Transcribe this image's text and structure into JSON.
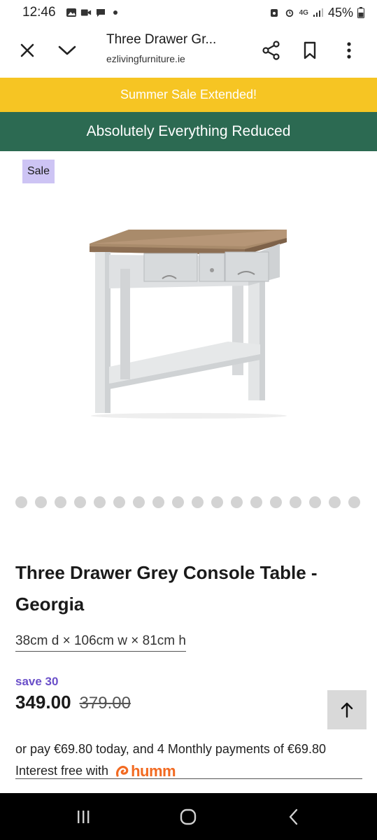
{
  "status_bar": {
    "time": "12:46",
    "battery": "45%",
    "network": "4G"
  },
  "browser": {
    "page_title": "Three Drawer Gr...",
    "url": "ezlivingfurniture.ie"
  },
  "banners": {
    "top": "Summer Sale Extended!",
    "bottom": "Absolutely Everything Reduced"
  },
  "product": {
    "badge": "Sale",
    "title": "Three Drawer Grey Console Table - Georgia",
    "dimensions": "38cm d × 106cm w × 81cm h",
    "save": "save 30",
    "price": "349.00",
    "old_price": "379.00",
    "image_count": 18
  },
  "payment": {
    "text": "or pay €69.80 today, and 4 Monthly payments of €69.80",
    "interest_text": "Interest free with",
    "provider": "humm"
  },
  "colors": {
    "yellow_banner": "#f6c523",
    "green_banner": "#2c6a52",
    "sale_badge": "#cdc4f4",
    "save_text": "#6a4fc9",
    "humm_orange": "#f26a21"
  }
}
